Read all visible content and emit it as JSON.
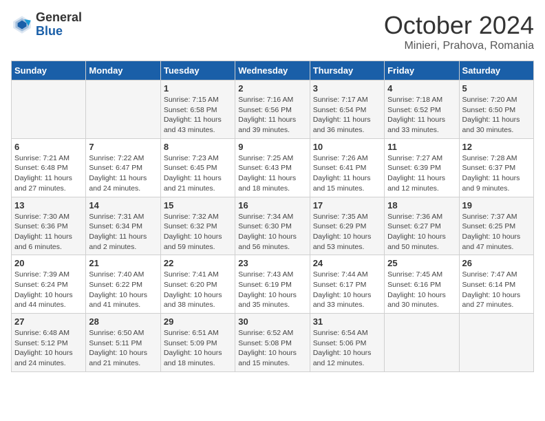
{
  "header": {
    "logo": {
      "general": "General",
      "blue": "Blue"
    },
    "title": "October 2024",
    "location": "Minieri, Prahova, Romania"
  },
  "days_of_week": [
    "Sunday",
    "Monday",
    "Tuesday",
    "Wednesday",
    "Thursday",
    "Friday",
    "Saturday"
  ],
  "weeks": [
    [
      {
        "day": "",
        "info": ""
      },
      {
        "day": "",
        "info": ""
      },
      {
        "day": "1",
        "info": "Sunrise: 7:15 AM\nSunset: 6:58 PM\nDaylight: 11 hours and 43 minutes."
      },
      {
        "day": "2",
        "info": "Sunrise: 7:16 AM\nSunset: 6:56 PM\nDaylight: 11 hours and 39 minutes."
      },
      {
        "day": "3",
        "info": "Sunrise: 7:17 AM\nSunset: 6:54 PM\nDaylight: 11 hours and 36 minutes."
      },
      {
        "day": "4",
        "info": "Sunrise: 7:18 AM\nSunset: 6:52 PM\nDaylight: 11 hours and 33 minutes."
      },
      {
        "day": "5",
        "info": "Sunrise: 7:20 AM\nSunset: 6:50 PM\nDaylight: 11 hours and 30 minutes."
      }
    ],
    [
      {
        "day": "6",
        "info": "Sunrise: 7:21 AM\nSunset: 6:48 PM\nDaylight: 11 hours and 27 minutes."
      },
      {
        "day": "7",
        "info": "Sunrise: 7:22 AM\nSunset: 6:47 PM\nDaylight: 11 hours and 24 minutes."
      },
      {
        "day": "8",
        "info": "Sunrise: 7:23 AM\nSunset: 6:45 PM\nDaylight: 11 hours and 21 minutes."
      },
      {
        "day": "9",
        "info": "Sunrise: 7:25 AM\nSunset: 6:43 PM\nDaylight: 11 hours and 18 minutes."
      },
      {
        "day": "10",
        "info": "Sunrise: 7:26 AM\nSunset: 6:41 PM\nDaylight: 11 hours and 15 minutes."
      },
      {
        "day": "11",
        "info": "Sunrise: 7:27 AM\nSunset: 6:39 PM\nDaylight: 11 hours and 12 minutes."
      },
      {
        "day": "12",
        "info": "Sunrise: 7:28 AM\nSunset: 6:37 PM\nDaylight: 11 hours and 9 minutes."
      }
    ],
    [
      {
        "day": "13",
        "info": "Sunrise: 7:30 AM\nSunset: 6:36 PM\nDaylight: 11 hours and 6 minutes."
      },
      {
        "day": "14",
        "info": "Sunrise: 7:31 AM\nSunset: 6:34 PM\nDaylight: 11 hours and 2 minutes."
      },
      {
        "day": "15",
        "info": "Sunrise: 7:32 AM\nSunset: 6:32 PM\nDaylight: 10 hours and 59 minutes."
      },
      {
        "day": "16",
        "info": "Sunrise: 7:34 AM\nSunset: 6:30 PM\nDaylight: 10 hours and 56 minutes."
      },
      {
        "day": "17",
        "info": "Sunrise: 7:35 AM\nSunset: 6:29 PM\nDaylight: 10 hours and 53 minutes."
      },
      {
        "day": "18",
        "info": "Sunrise: 7:36 AM\nSunset: 6:27 PM\nDaylight: 10 hours and 50 minutes."
      },
      {
        "day": "19",
        "info": "Sunrise: 7:37 AM\nSunset: 6:25 PM\nDaylight: 10 hours and 47 minutes."
      }
    ],
    [
      {
        "day": "20",
        "info": "Sunrise: 7:39 AM\nSunset: 6:24 PM\nDaylight: 10 hours and 44 minutes."
      },
      {
        "day": "21",
        "info": "Sunrise: 7:40 AM\nSunset: 6:22 PM\nDaylight: 10 hours and 41 minutes."
      },
      {
        "day": "22",
        "info": "Sunrise: 7:41 AM\nSunset: 6:20 PM\nDaylight: 10 hours and 38 minutes."
      },
      {
        "day": "23",
        "info": "Sunrise: 7:43 AM\nSunset: 6:19 PM\nDaylight: 10 hours and 35 minutes."
      },
      {
        "day": "24",
        "info": "Sunrise: 7:44 AM\nSunset: 6:17 PM\nDaylight: 10 hours and 33 minutes."
      },
      {
        "day": "25",
        "info": "Sunrise: 7:45 AM\nSunset: 6:16 PM\nDaylight: 10 hours and 30 minutes."
      },
      {
        "day": "26",
        "info": "Sunrise: 7:47 AM\nSunset: 6:14 PM\nDaylight: 10 hours and 27 minutes."
      }
    ],
    [
      {
        "day": "27",
        "info": "Sunrise: 6:48 AM\nSunset: 5:12 PM\nDaylight: 10 hours and 24 minutes."
      },
      {
        "day": "28",
        "info": "Sunrise: 6:50 AM\nSunset: 5:11 PM\nDaylight: 10 hours and 21 minutes."
      },
      {
        "day": "29",
        "info": "Sunrise: 6:51 AM\nSunset: 5:09 PM\nDaylight: 10 hours and 18 minutes."
      },
      {
        "day": "30",
        "info": "Sunrise: 6:52 AM\nSunset: 5:08 PM\nDaylight: 10 hours and 15 minutes."
      },
      {
        "day": "31",
        "info": "Sunrise: 6:54 AM\nSunset: 5:06 PM\nDaylight: 10 hours and 12 minutes."
      },
      {
        "day": "",
        "info": ""
      },
      {
        "day": "",
        "info": ""
      }
    ]
  ]
}
